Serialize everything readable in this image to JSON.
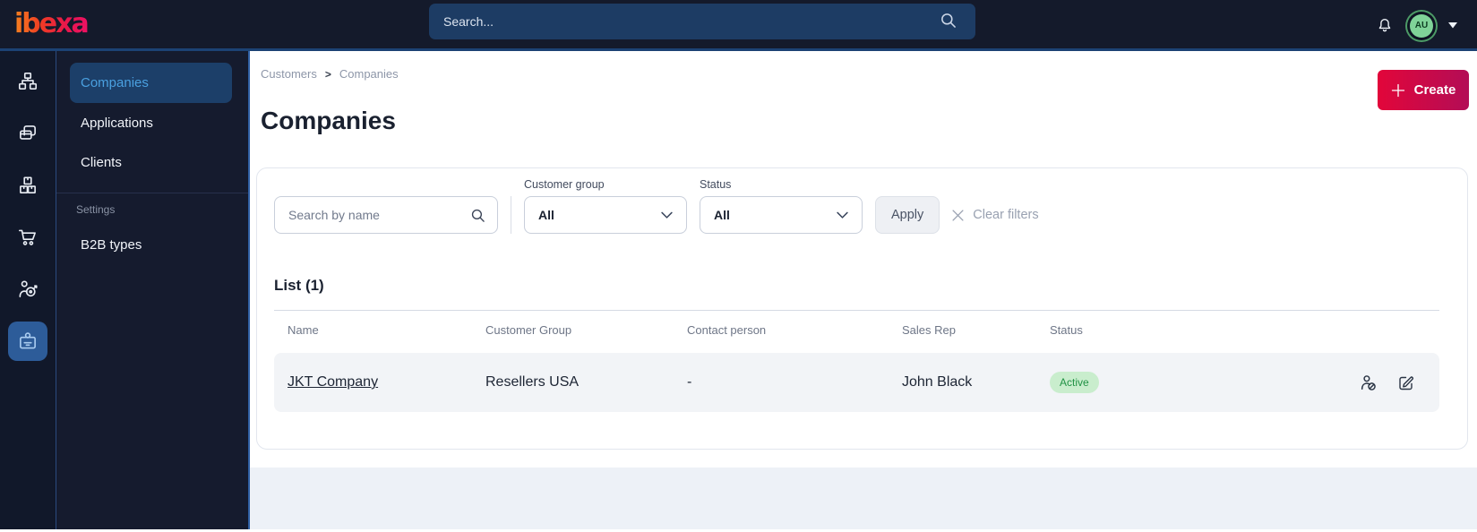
{
  "colors": {
    "topbar_bg": "#141a2b",
    "topbar_border": "#1c4274",
    "search_bg": "#1d3c64",
    "brand_gradient_start": "#f5821f",
    "brand_gradient_end": "#ed1164",
    "accent_blue": "#4aa0e0",
    "selected_tile_bg": "#2d5c99",
    "create_gradient_start": "#e2063a",
    "create_gradient_end": "#b30d56",
    "active_badge_bg": "#c9edcd",
    "active_badge_text": "#219245",
    "avatar_bg": "#7fd398"
  },
  "topbar": {
    "brand": "ibexa",
    "search_placeholder": "Search...",
    "avatar_initials": "AU",
    "icons": [
      "search-icon",
      "bell-icon",
      "avatar",
      "caret-down-icon"
    ]
  },
  "sidebar": {
    "rail_icons": [
      "org-chart-icon",
      "pages-icon",
      "products-boxes-icon",
      "cart-icon",
      "marketing-target-icon",
      "company-badge-icon"
    ],
    "active_rail_index": 5
  },
  "nav": {
    "items": [
      {
        "label": "Companies",
        "active": true
      },
      {
        "label": "Applications",
        "active": false
      },
      {
        "label": "Clients",
        "active": false
      }
    ],
    "section_label": "Settings",
    "section_items": [
      {
        "label": "B2B types"
      }
    ]
  },
  "page": {
    "breadcrumb": {
      "items": [
        "Customers",
        "Companies"
      ],
      "separator": ">"
    },
    "title": "Companies",
    "create_button": "Create"
  },
  "filters": {
    "search_placeholder": "Search by name",
    "customer_group": {
      "label": "Customer group",
      "value": "All"
    },
    "status": {
      "label": "Status",
      "value": "All"
    },
    "apply_label": "Apply",
    "clear_label": "Clear filters"
  },
  "list": {
    "title": "List (1)",
    "columns": [
      "Name",
      "Customer Group",
      "Contact person",
      "Sales Rep",
      "Status"
    ],
    "rows": [
      {
        "name": "JKT Company",
        "customer_group": "Resellers USA",
        "contact_person": "-",
        "sales_rep": "John Black",
        "status": "Active",
        "actions": [
          "impersonate-user-icon",
          "edit-icon"
        ]
      }
    ]
  }
}
